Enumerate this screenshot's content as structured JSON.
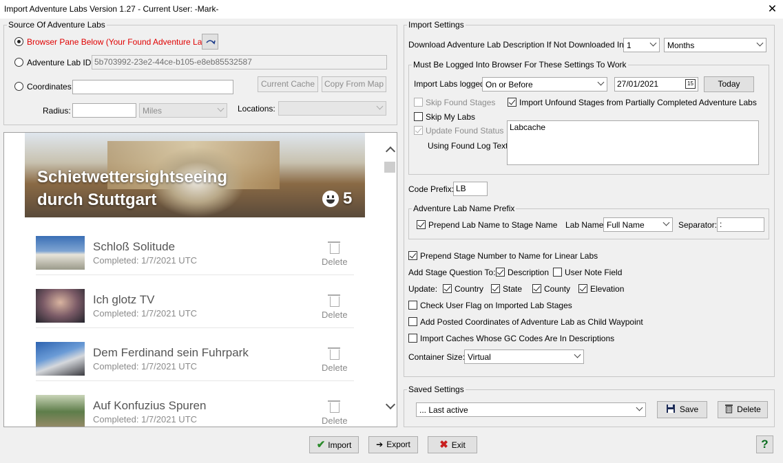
{
  "window": {
    "title": "Import Adventure Labs Version 1.27 - Current User: -Mark-",
    "close_glyph": "✕"
  },
  "source": {
    "legend": "Source Of Adventure Labs",
    "browser_pane_label": "Browser Pane Below (Your Found Adventure Labs)",
    "lab_id_label": "Adventure Lab ID:",
    "lab_id_value": "5b703992-23e2-44ce-b105-e8eb85532587",
    "coordinates_label": "Coordinates:",
    "coordinates_value": "",
    "current_cache_btn": "Current Cache",
    "copy_from_map_btn": "Copy From Map",
    "radius_label": "Radius:",
    "radius_value": "",
    "radius_unit": "Miles",
    "locations_label": "Locations:",
    "locations_value": ""
  },
  "browser": {
    "hero_title_line1": "Schietwettersightseeing",
    "hero_title_line2": "durch Stuttgart",
    "hero_count": "5",
    "items": [
      {
        "title": "Schloß Solitude",
        "status": "Completed: 1/7/2021 UTC",
        "delete": "Delete"
      },
      {
        "title": "Ich glotz TV",
        "status": "Completed: 1/7/2021 UTC",
        "delete": "Delete"
      },
      {
        "title": "Dem Ferdinand sein Fuhrpark",
        "status": "Completed: 1/7/2021 UTC",
        "delete": "Delete"
      },
      {
        "title": "Auf Konfuzius Spuren",
        "status": "Completed: 1/7/2021 UTC",
        "delete": "Delete"
      }
    ]
  },
  "import_settings": {
    "legend": "Import Settings",
    "download_label": "Download Adventure Lab Description If Not Downloaded In Last",
    "download_num": "1",
    "download_unit": "Months",
    "logged_group": {
      "legend": "Must Be Logged Into Browser For These Settings To Work",
      "import_logged_label": "Import Labs logged",
      "import_logged_value": "On or Before",
      "date_value": "27/01/2021",
      "today_btn": "Today",
      "skip_found_label": "Skip Found Stages",
      "import_unfound_label": "Import Unfound Stages from Partially Completed Adventure Labs",
      "skip_my_labs_label": "Skip My Labs",
      "update_found_label": "Update Found Status",
      "using_log_label": "Using Found Log Text:",
      "log_text": "Labcache"
    },
    "code_prefix_label": "Code Prefix:",
    "code_prefix_value": "LB",
    "name_prefix": {
      "legend": "Adventure Lab Name Prefix",
      "prepend_label": "Prepend Lab Name to Stage Name",
      "lab_name_label": "Lab Name:",
      "lab_name_value": "Full Name",
      "separator_label": "Separator:",
      "separator_value": ":"
    },
    "prepend_stage_label": "Prepend Stage Number to Name for Linear Labs",
    "add_question_label": "Add Stage Question To:",
    "description_label": "Description",
    "user_note_label": "User Note Field",
    "update_label": "Update:",
    "country_label": "Country",
    "state_label": "State",
    "county_label": "County",
    "elevation_label": "Elevation",
    "check_flag_label": "Check User Flag on Imported Lab Stages",
    "add_posted_label": "Add Posted Coordinates of Adventure Lab as Child Waypoint",
    "import_gc_label": "Import Caches Whose GC Codes Are In Descriptions",
    "container_label": "Container Size:",
    "container_value": "Virtual"
  },
  "saved": {
    "legend": "Saved Settings",
    "value": "... Last active",
    "save_btn": "Save",
    "delete_btn": "Delete"
  },
  "footer": {
    "import_btn": "Import",
    "export_btn": "Export",
    "exit_btn": "Exit",
    "help_btn": "?"
  }
}
